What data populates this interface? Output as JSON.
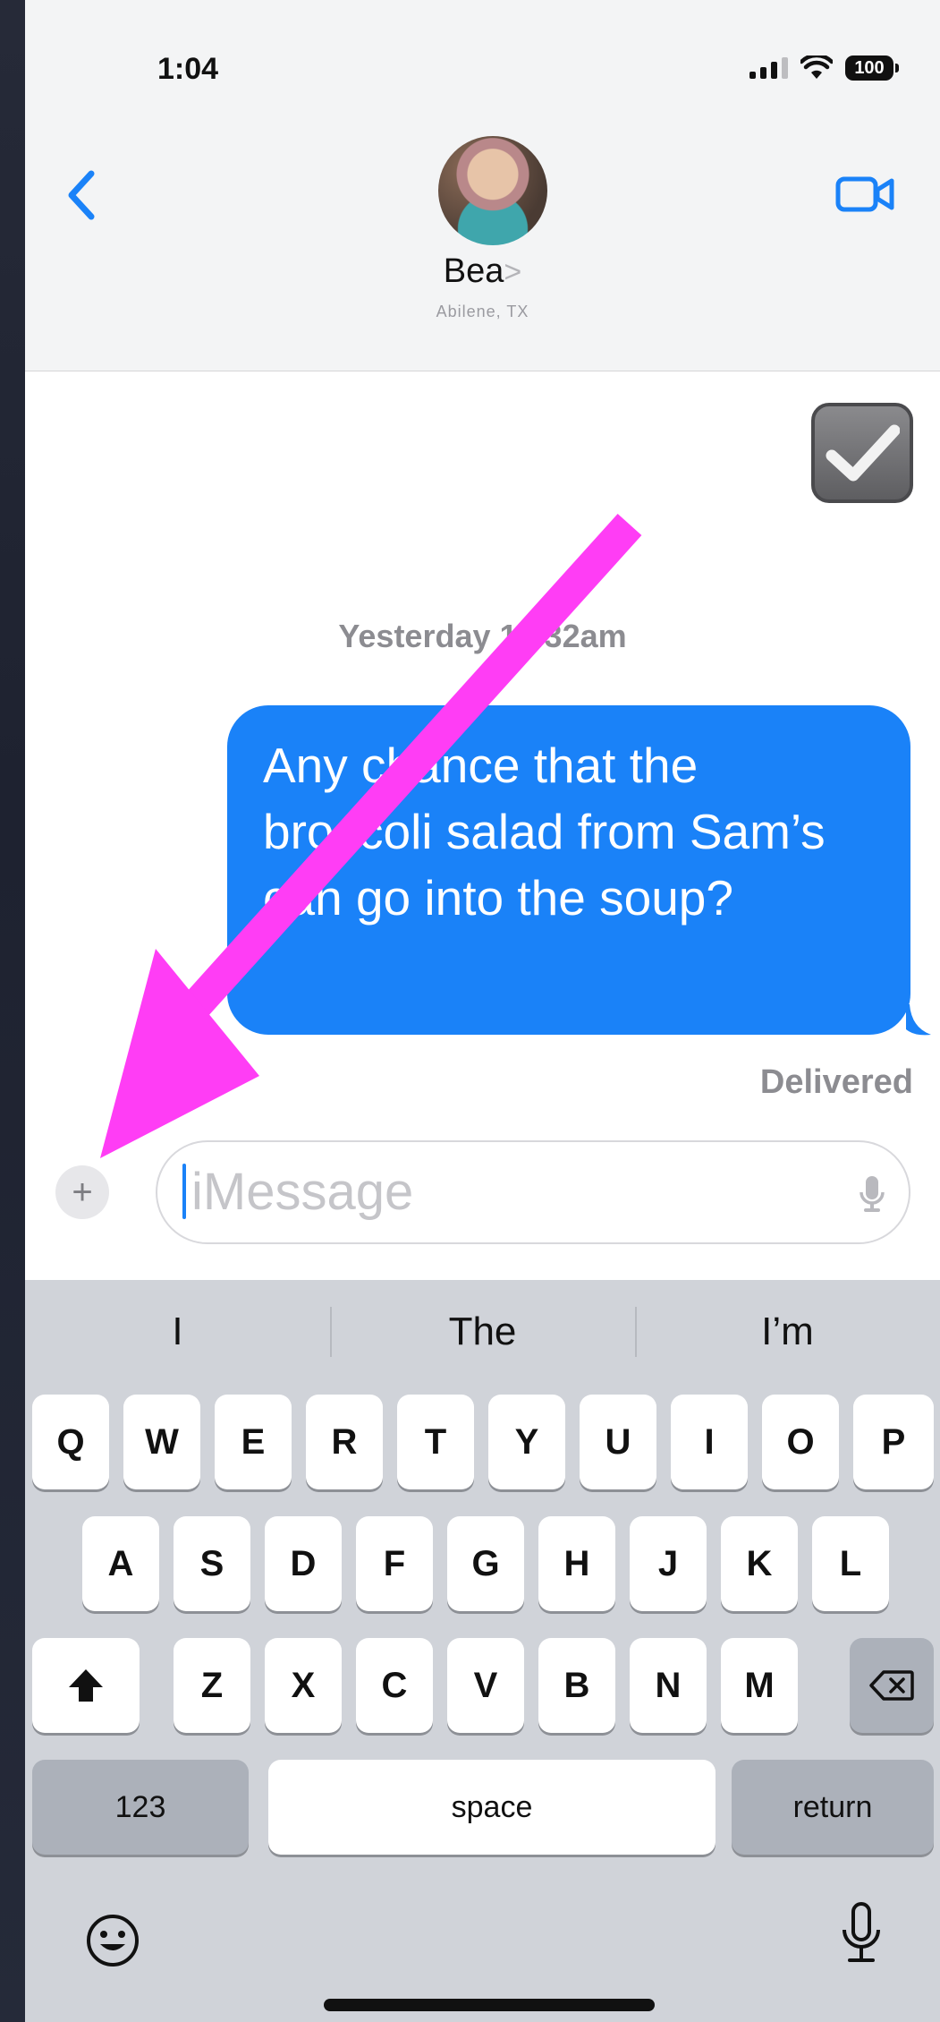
{
  "status_bar": {
    "time": "1:04",
    "battery": "100"
  },
  "header": {
    "contact_name": "Bea",
    "contact_chevron": ">",
    "location": "Abilene, TX"
  },
  "conversation": {
    "timestamp": "Yesterday 11:32am",
    "message": "Any chance that the broccoli salad from Sam’s can go into the soup?",
    "status": "Delivered"
  },
  "compose": {
    "plus_label": "+",
    "placeholder": "iMessage"
  },
  "keyboard": {
    "suggestions": [
      "I",
      "The",
      "I’m"
    ],
    "row1": [
      "Q",
      "W",
      "E",
      "R",
      "T",
      "Y",
      "U",
      "I",
      "O",
      "P"
    ],
    "row2": [
      "A",
      "S",
      "D",
      "F",
      "G",
      "H",
      "J",
      "K",
      "L"
    ],
    "row3": [
      "Z",
      "X",
      "C",
      "V",
      "B",
      "N",
      "M"
    ],
    "numbers_label": "123",
    "space_label": "space",
    "return_label": "return"
  },
  "colors": {
    "bubble": "#1a82f8",
    "annotation_arrow": "#ff3df5"
  },
  "icons": {
    "back": "chevron-left-icon",
    "video": "video-camera-icon",
    "dictation": "microphone-icon",
    "emoji": "emoji-face-icon",
    "shift": "shift-arrow-icon",
    "delete": "backspace-icon"
  }
}
